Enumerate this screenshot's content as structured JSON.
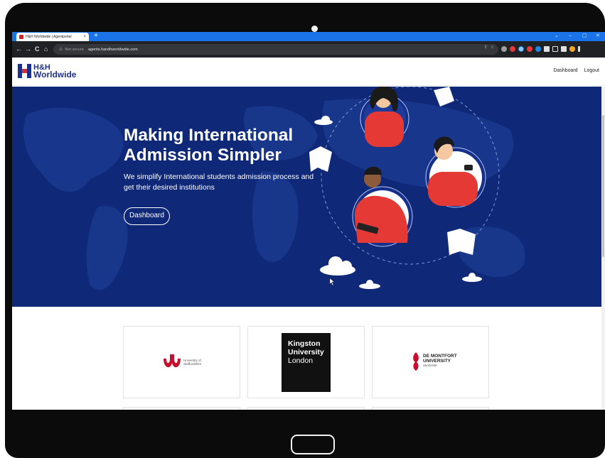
{
  "browser": {
    "tab_title": "H&H Worldwide | Agentportal",
    "tab_close": "×",
    "new_tab": "+",
    "window_controls": [
      "⌄",
      "–",
      "▢",
      "✕"
    ],
    "nav": {
      "back": "←",
      "forward": "→",
      "reload": "C",
      "home": "⌂"
    },
    "security_icon": "⚠",
    "security_label": "Not secure",
    "url": "agents.handhworldwide.com",
    "omnibox_icons": [
      "⇪",
      "☆"
    ]
  },
  "site": {
    "logo_line1": "H&H",
    "logo_line2": "Worldwide",
    "nav": {
      "dashboard": "Dashboard",
      "logout": "Logout"
    }
  },
  "hero": {
    "title_line1": "Making International",
    "title_line2": "Admission Simpler",
    "subtitle_line1": "We simplify International students admission process and",
    "subtitle_line2": "get their desired institutions",
    "button_label": "Dashboard"
  },
  "universities": {
    "staffordshire_line1": "University of",
    "staffordshire_line2": "Staffordshire",
    "kingston_line1": "Kingston",
    "kingston_line2": "University",
    "kingston_line3": "London",
    "dmu_line1": "DE MONTFORT",
    "dmu_line2": "UNIVERSITY",
    "dmu_line3": "LEICESTER"
  },
  "colors": {
    "brand_blue": "#1d2f8c",
    "hero_bg": "#0f2978",
    "accent_red": "#d32f2f",
    "tab_bar": "#1a73e8"
  }
}
